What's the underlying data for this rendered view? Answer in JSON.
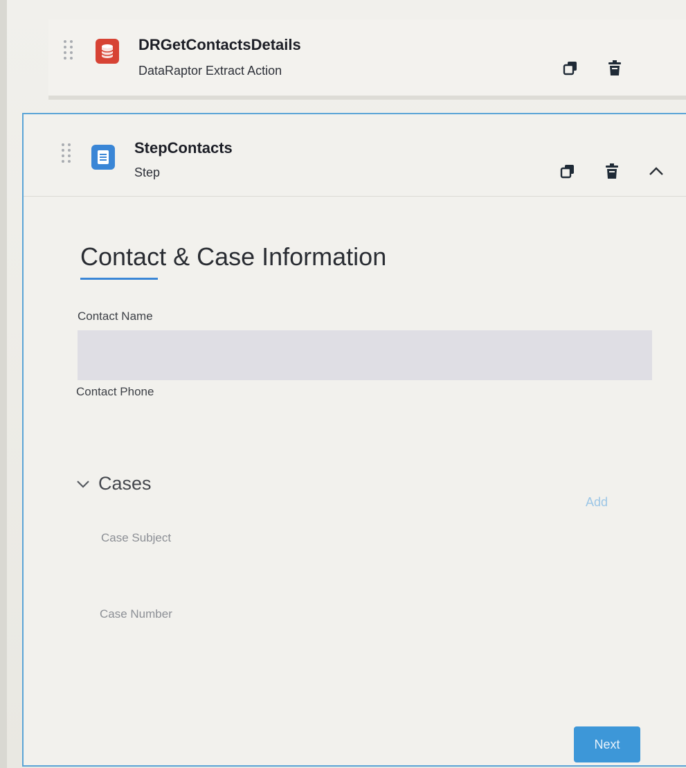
{
  "dataraptor_element": {
    "name": "DRGetContactsDetails",
    "type_label": "DataRaptor Extract Action",
    "icon": "database-icon",
    "icon_color": "#d74334"
  },
  "step_element": {
    "name": "StepContacts",
    "type_label": "Step",
    "icon": "document-icon",
    "icon_color": "#3a86d6",
    "block_title": "Contact & Case Information",
    "fields": {
      "contact_name_label": "Contact Name",
      "contact_phone_label": "Contact Phone"
    },
    "cases_block": {
      "label": "Cases",
      "add_label": "Add",
      "case_subject_label": "Case Subject",
      "case_number_label": "Case Number"
    },
    "next_label": "Next"
  },
  "colors": {
    "accent_blue": "#3a86d6",
    "selected_border": "#5aa4d6",
    "button_blue": "#3d97d8"
  }
}
